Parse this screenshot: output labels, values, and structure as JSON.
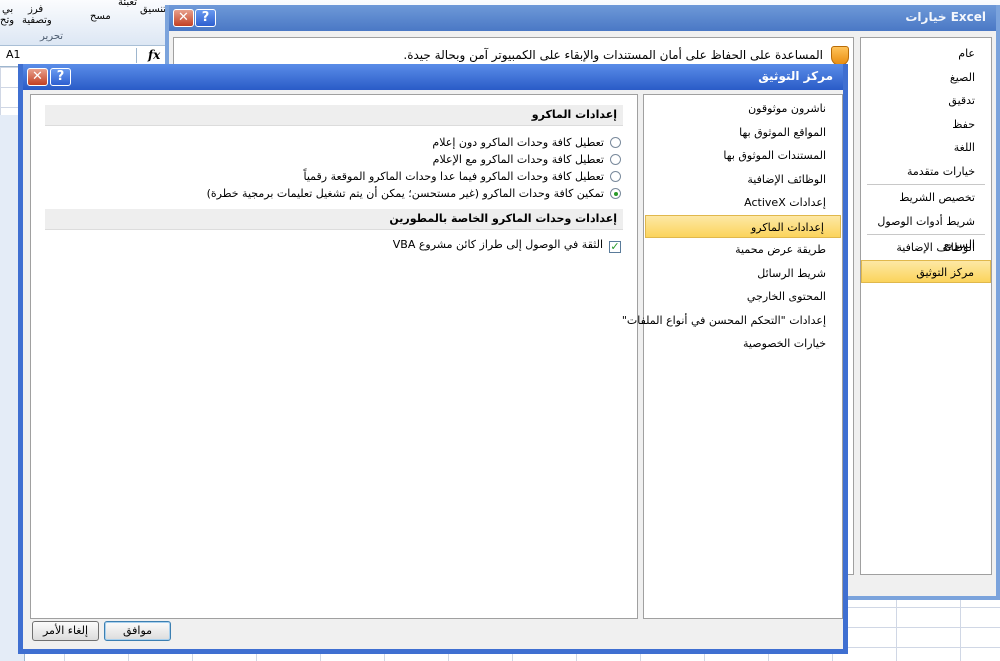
{
  "background": {
    "ribbon": {
      "items": [
        "تعبئة",
        "فرز",
        "وتصفية",
        "مسح",
        "تنسيق",
        "بي",
        "وتح"
      ],
      "group_label": "تحرير"
    },
    "name_box": "A1",
    "fx": "fx"
  },
  "excel_options": {
    "title": "خيارات Excel",
    "description": "المساعدة على الحفاظ على أمان المستندات والإبقاء على الكمبيوتر آمن وبحالة جيدة.",
    "nav": [
      {
        "label": "عام"
      },
      {
        "label": "الصيغ"
      },
      {
        "label": "تدقيق"
      },
      {
        "label": "حفظ"
      },
      {
        "label": "اللغة"
      },
      {
        "label": "خيارات متقدمة"
      },
      {
        "label": "تخصيص الشريط"
      },
      {
        "label": "شريط أدوات الوصول السريع"
      },
      {
        "label": "الوظائف الإضافية"
      },
      {
        "label": "مركز التوثيق"
      }
    ],
    "selected": "مركز التوثيق"
  },
  "trust_center": {
    "title": "مركز التوثيق",
    "nav": [
      {
        "label": "ناشرون موثوقون"
      },
      {
        "label": "المواقع الموثوق بها"
      },
      {
        "label": "المستندات الموثوق بها"
      },
      {
        "label": "الوظائف الإضافية"
      },
      {
        "label": "إعدادات ActiveX"
      },
      {
        "label": "إعدادات الماكرو"
      },
      {
        "label": "طريقة عرض محمية"
      },
      {
        "label": "شريط الرسائل"
      },
      {
        "label": "المحتوى الخارجي"
      },
      {
        "label": "إعدادات \"التحكم المحسن في أنواع الملفات\""
      },
      {
        "label": "خيارات الخصوصية"
      }
    ],
    "selected": "إعدادات الماكرو",
    "macro_section": {
      "heading": "إعدادات الماكرو",
      "options": [
        {
          "label": "تعطيل كافة وحدات الماكرو دون إعلام",
          "checked": false
        },
        {
          "label": "تعطيل كافة وحدات الماكرو مع الإعلام",
          "checked": false
        },
        {
          "label": "تعطيل كافة وحدات الماكرو فيما عدا وحدات الماكرو الموقعة رقمياً",
          "checked": false
        },
        {
          "label": "تمكين كافة وحدات الماكرو (غير مستحسن؛ يمكن أن يتم تشغيل تعليمات برمجية خطرة)",
          "checked": true
        }
      ]
    },
    "developer_section": {
      "heading": "إعدادات وحدات الماكرو الخاصة بالمطورين",
      "vba_trust_label": "الثقة في الوصول إلى طراز كائن مشروع VBA",
      "vba_trust_checked": true
    },
    "ok_label": "موافق",
    "cancel_label": "إلغاء الأمر"
  },
  "colors": {
    "trust_title": "#2a5bc7",
    "options_title": "#4a78c5",
    "selected_nav": "#fbd45c"
  }
}
